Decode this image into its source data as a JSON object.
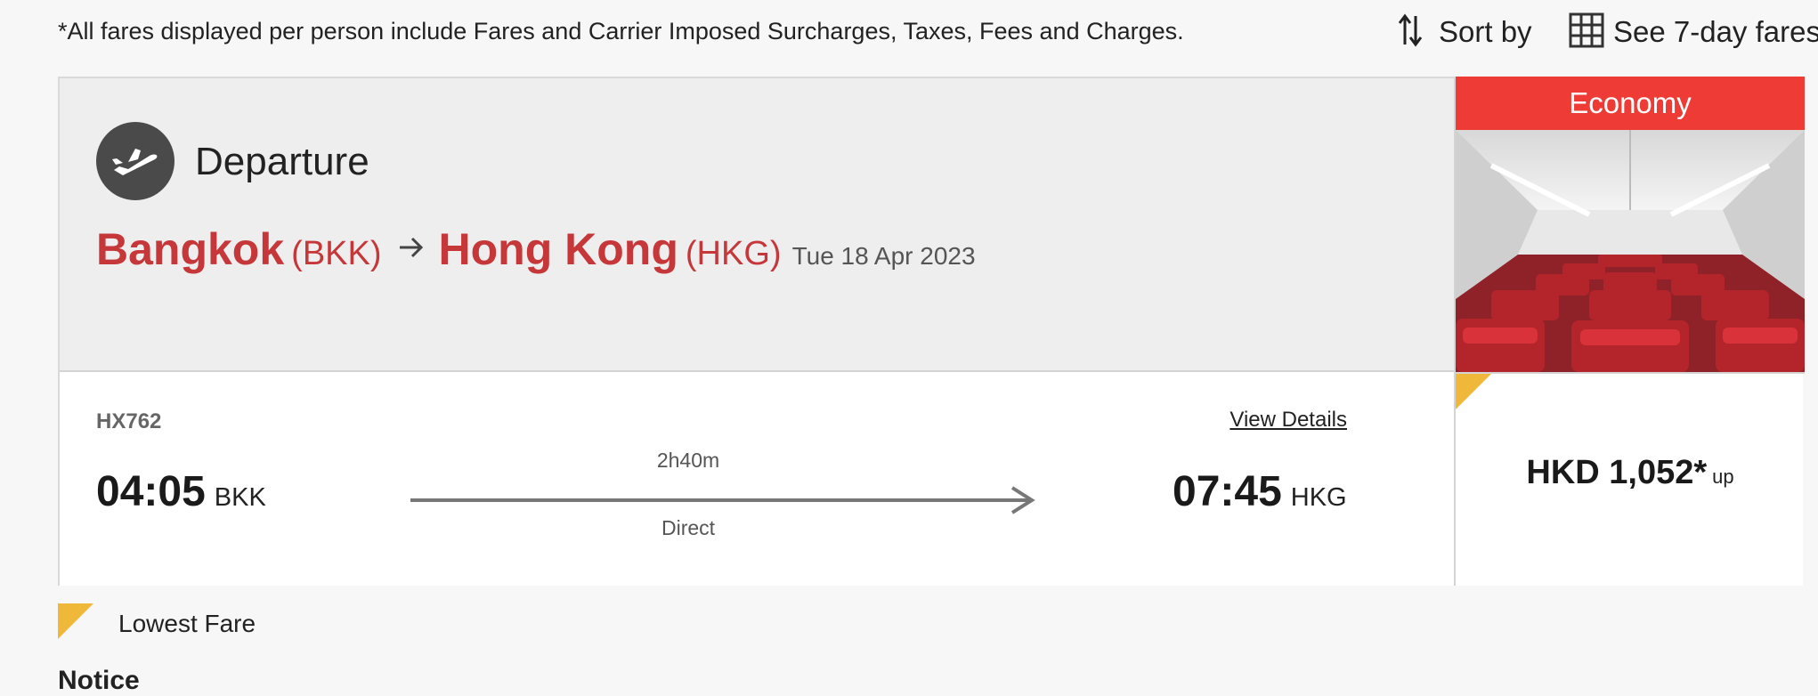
{
  "disclaimer": "*All fares displayed per person include Fares and Carrier Imposed Surcharges, Taxes, Fees and Charges.",
  "toolbar": {
    "sort_label": "Sort by",
    "sort_icon": "sort-arrows-icon",
    "sevenday_label": "See 7-day fares",
    "sevenday_icon": "calendar-grid-icon"
  },
  "journey": {
    "label": "Departure",
    "icon": "plane-takeoff-icon",
    "origin_city": "Bangkok",
    "origin_code": "(BKK)",
    "dest_city": "Hong Kong",
    "dest_code": "(HKG)",
    "date": "Tue 18 Apr 2023"
  },
  "flight": {
    "number": "HX762",
    "view_details": "View Details",
    "dep_time": "04:05",
    "dep_code": "BKK",
    "arr_time": "07:45",
    "arr_code": "HKG",
    "duration": "2h40m",
    "stops": "Direct"
  },
  "fare": {
    "cabin": "Economy",
    "price": "HKD 1,052*",
    "suffix": "up",
    "is_lowest": true
  },
  "legend": {
    "lowest_fare_label": "Lowest Fare"
  },
  "colors": {
    "brand_red": "#c6373a",
    "cabin_header": "#ee3b35",
    "lowest_flag": "#f0b83a"
  },
  "notice_heading": "Notice"
}
